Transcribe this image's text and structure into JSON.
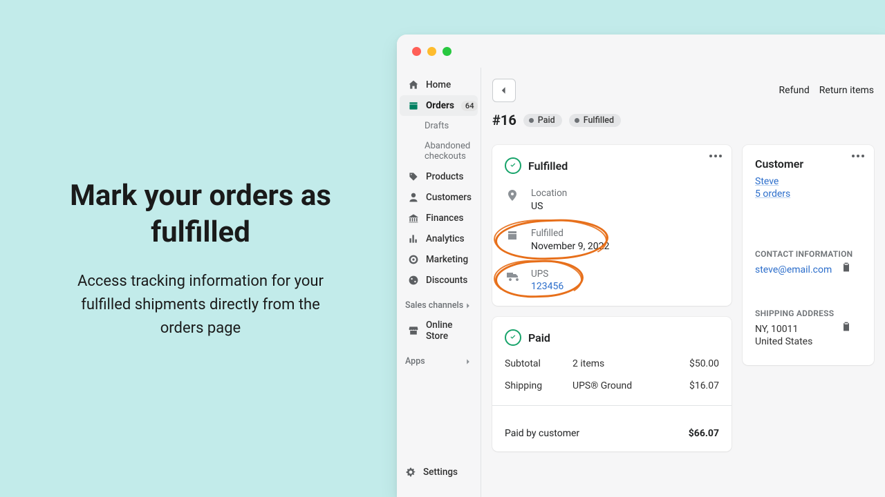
{
  "hero": {
    "title": "Mark your orders as fulfilled",
    "subtitle": "Access tracking information for your fulfilled shipments directly from the orders page"
  },
  "sidebar": {
    "items": [
      {
        "label": "Home"
      },
      {
        "label": "Orders",
        "badge": "64"
      },
      {
        "label": "Drafts"
      },
      {
        "label": "Abandoned checkouts"
      },
      {
        "label": "Products"
      },
      {
        "label": "Customers"
      },
      {
        "label": "Finances"
      },
      {
        "label": "Analytics"
      },
      {
        "label": "Marketing"
      },
      {
        "label": "Discounts"
      }
    ],
    "sales_channels_label": "Sales channels",
    "online_store_label": "Online Store",
    "apps_label": "Apps",
    "settings_label": "Settings"
  },
  "topbar": {
    "refund_label": "Refund",
    "return_label": "Return items"
  },
  "order": {
    "number": "#16",
    "badges": [
      {
        "label": "Paid"
      },
      {
        "label": "Fulfilled"
      }
    ]
  },
  "fulfilled_card": {
    "title": "Fulfilled",
    "location_label": "Location",
    "location_value": "US",
    "status_label": "Fulfilled",
    "status_value": "November 9, 2022",
    "carrier_label": "UPS",
    "tracking_number": "123456"
  },
  "paid_card": {
    "title": "Paid",
    "rows": [
      {
        "label": "Subtotal",
        "desc": "2 items",
        "amount": "$50.00"
      },
      {
        "label": "Shipping",
        "desc": "UPS® Ground",
        "amount": "$16.07"
      }
    ],
    "total_label": "Paid by customer",
    "total_amount": "$66.07"
  },
  "customer_card": {
    "title": "Customer",
    "name": "Steve",
    "orders_text": "5 orders",
    "contact_heading": "CONTACT INFORMATION",
    "email": "steve@email.com",
    "shipping_heading": "SHIPPING ADDRESS",
    "address_line1": "NY, 10011",
    "address_line2": "United States"
  }
}
